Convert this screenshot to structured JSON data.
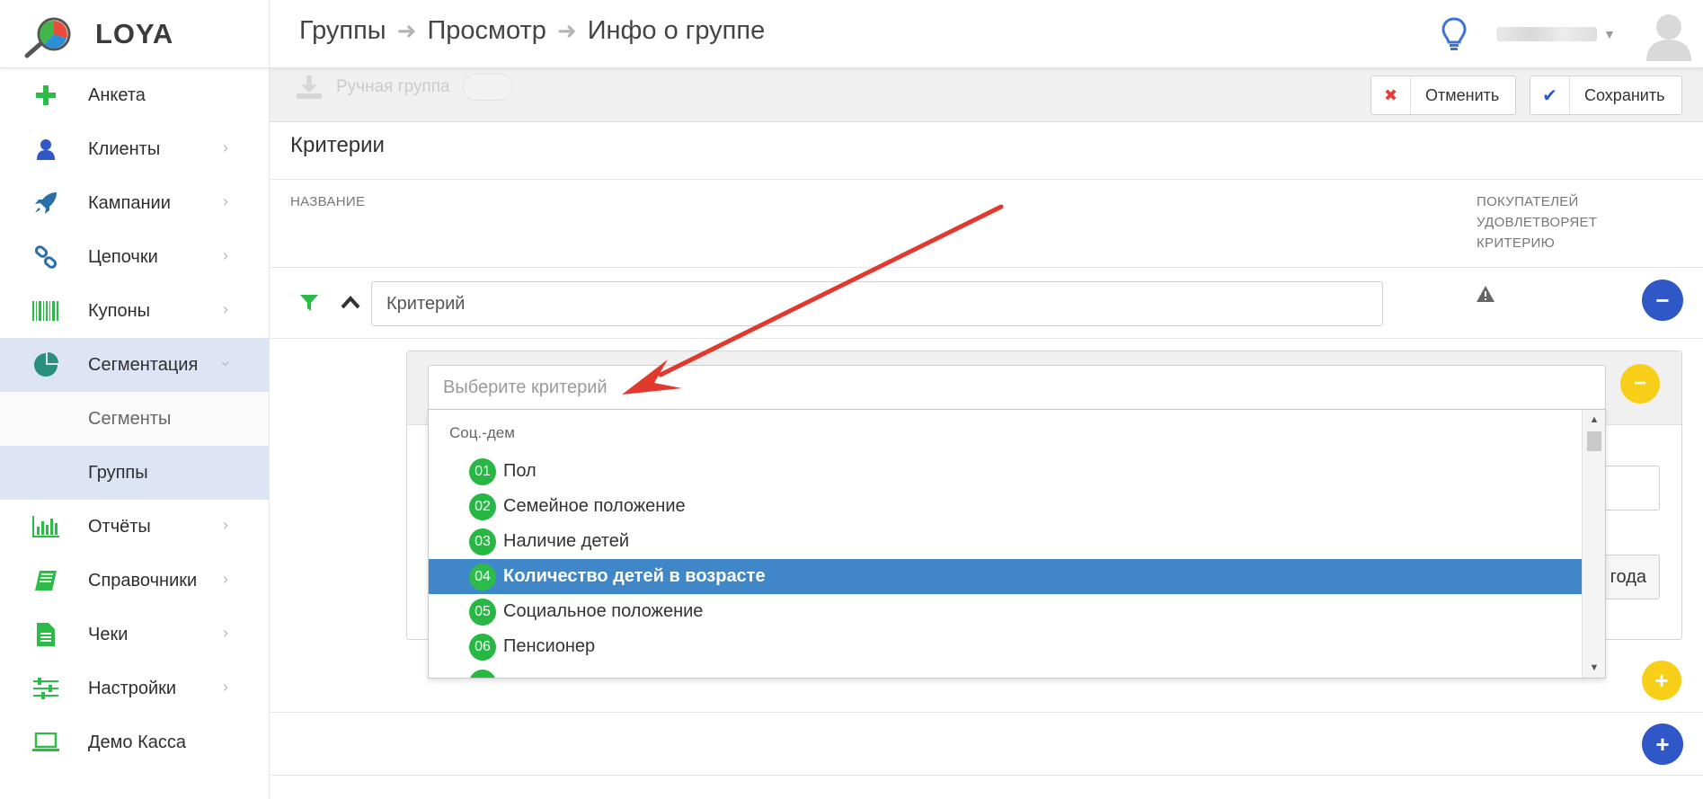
{
  "app": {
    "logo_text": "LOYA"
  },
  "breadcrumb": [
    "Группы",
    "Просмотр",
    "Инфо о группе"
  ],
  "sidebar": {
    "items": [
      {
        "label": "Анкета",
        "icon": "plus-icon"
      },
      {
        "label": "Клиенты",
        "icon": "user-icon"
      },
      {
        "label": "Кампании",
        "icon": "rocket-icon"
      },
      {
        "label": "Цепочки",
        "icon": "link-icon"
      },
      {
        "label": "Купоны",
        "icon": "barcode-icon"
      },
      {
        "label": "Сегментация",
        "icon": "pie-chart-icon"
      },
      {
        "label": "Сегменты"
      },
      {
        "label": "Группы"
      },
      {
        "label": "Отчёты",
        "icon": "bar-chart-icon"
      },
      {
        "label": "Справочники",
        "icon": "book-icon"
      },
      {
        "label": "Чеки",
        "icon": "receipt-icon"
      },
      {
        "label": "Настройки",
        "icon": "sliders-icon"
      },
      {
        "label": "Демо Касса",
        "icon": "laptop-icon"
      }
    ]
  },
  "toolbar": {
    "manual_group_label": "Ручная группа",
    "cancel_label": "Отменить",
    "save_label": "Сохранить"
  },
  "criteria": {
    "title": "Критерии",
    "col_name": "НАЗВАНИЕ",
    "col_buyers": [
      "ПОКУПАТЕЛЕЙ",
      "УДОВЛЕТВОРЯЕТ",
      "КРИТЕРИЮ"
    ],
    "row_value": "Критерий",
    "select_placeholder": "Выберите критерий",
    "hidden_button_text": "года"
  },
  "dropdown": {
    "group": "Соц.-дем",
    "options": [
      {
        "num": "01",
        "label": "Пол"
      },
      {
        "num": "02",
        "label": "Семейное положение"
      },
      {
        "num": "03",
        "label": "Наличие детей"
      },
      {
        "num": "04",
        "label": "Количество детей в возрасте",
        "selected": true
      },
      {
        "num": "05",
        "label": "Социальное положение"
      },
      {
        "num": "06",
        "label": "Пенсионер"
      }
    ]
  },
  "colors": {
    "accent_blue": "#2f57c7",
    "accent_yellow": "#f7cf18",
    "highlight": "#3f87c9",
    "badge_green": "#27b844",
    "annotation_arrow": "#e2392e"
  }
}
